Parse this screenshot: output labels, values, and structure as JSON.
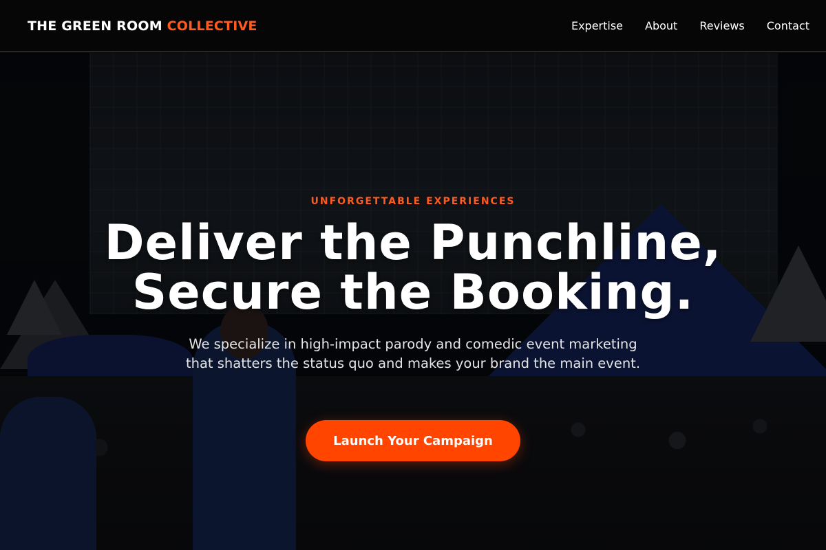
{
  "header": {
    "logo_main": "THE GREEN ROOM ",
    "logo_accent": "COLLECTIVE",
    "nav": [
      "Expertise",
      "About",
      "Reviews",
      "Contact"
    ]
  },
  "hero": {
    "eyebrow": "UNFORGETTABLE EXPERIENCES",
    "headline_line1": "Deliver the Punchline,",
    "headline_line2": "Secure the Booking.",
    "subtext": "We specialize in high-impact parody and comedic event marketing that shatters the status quo and makes your brand the main event.",
    "cta_label": "Launch Your Campaign"
  },
  "colors": {
    "accent": "#ff5a1f",
    "cta_background": "#ff4500",
    "header_background": "#060606"
  }
}
